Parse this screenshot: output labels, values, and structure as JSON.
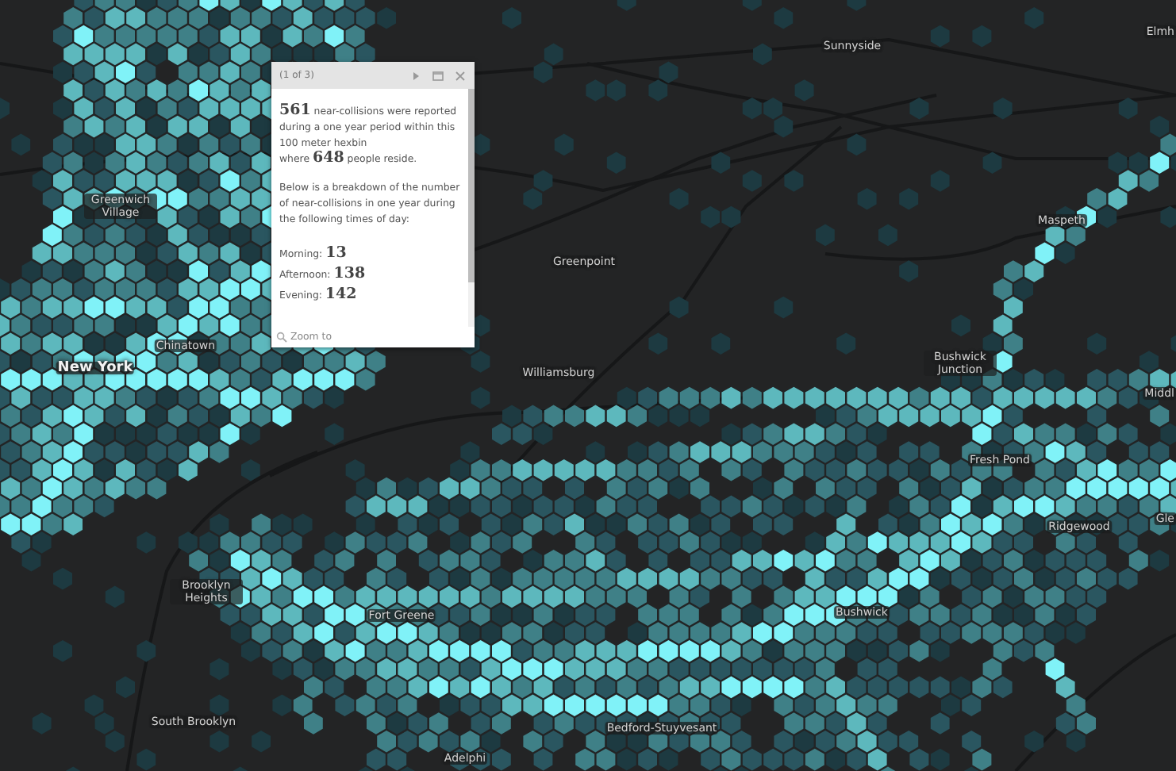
{
  "map_labels": [
    {
      "text": "Sunnyside",
      "kind": "place"
    },
    {
      "text": "Elmh",
      "kind": "place"
    },
    {
      "text": "Greenwich Village",
      "kind": "place"
    },
    {
      "text": "Greenpoint",
      "kind": "place"
    },
    {
      "text": "Chinatown",
      "kind": "place"
    },
    {
      "text": "New York",
      "kind": "city"
    },
    {
      "text": "Williamsburg",
      "kind": "place"
    },
    {
      "text": "Maspeth",
      "kind": "place"
    },
    {
      "text": "Bushwick Junction",
      "kind": "place"
    },
    {
      "text": "Middl",
      "kind": "place"
    },
    {
      "text": "Fresh Pond",
      "kind": "place"
    },
    {
      "text": "Ridgewood",
      "kind": "place"
    },
    {
      "text": "Gle",
      "kind": "place"
    },
    {
      "text": "Brooklyn Heights",
      "kind": "place"
    },
    {
      "text": "Fort Greene",
      "kind": "place"
    },
    {
      "text": "Bushwick",
      "kind": "place"
    },
    {
      "text": "South Brooklyn",
      "kind": "place"
    },
    {
      "text": "Bedford-Stuyvesant",
      "kind": "place"
    },
    {
      "text": "Adelphi",
      "kind": "place"
    }
  ],
  "popup": {
    "title": "(1 of 3)",
    "paragraphs": [
      "**561** near-collisions were reported during a one year period within this 100 meter hexbin",
      "where **648** people reside.",
      "Below is a breakdown of the number of near-collisions in one year during the following times of day:"
    ],
    "stats": [
      "Morning: **13**",
      "Afternoon: **138**",
      "Evening: **142**"
    ],
    "footer_link": "Zoom to"
  }
}
